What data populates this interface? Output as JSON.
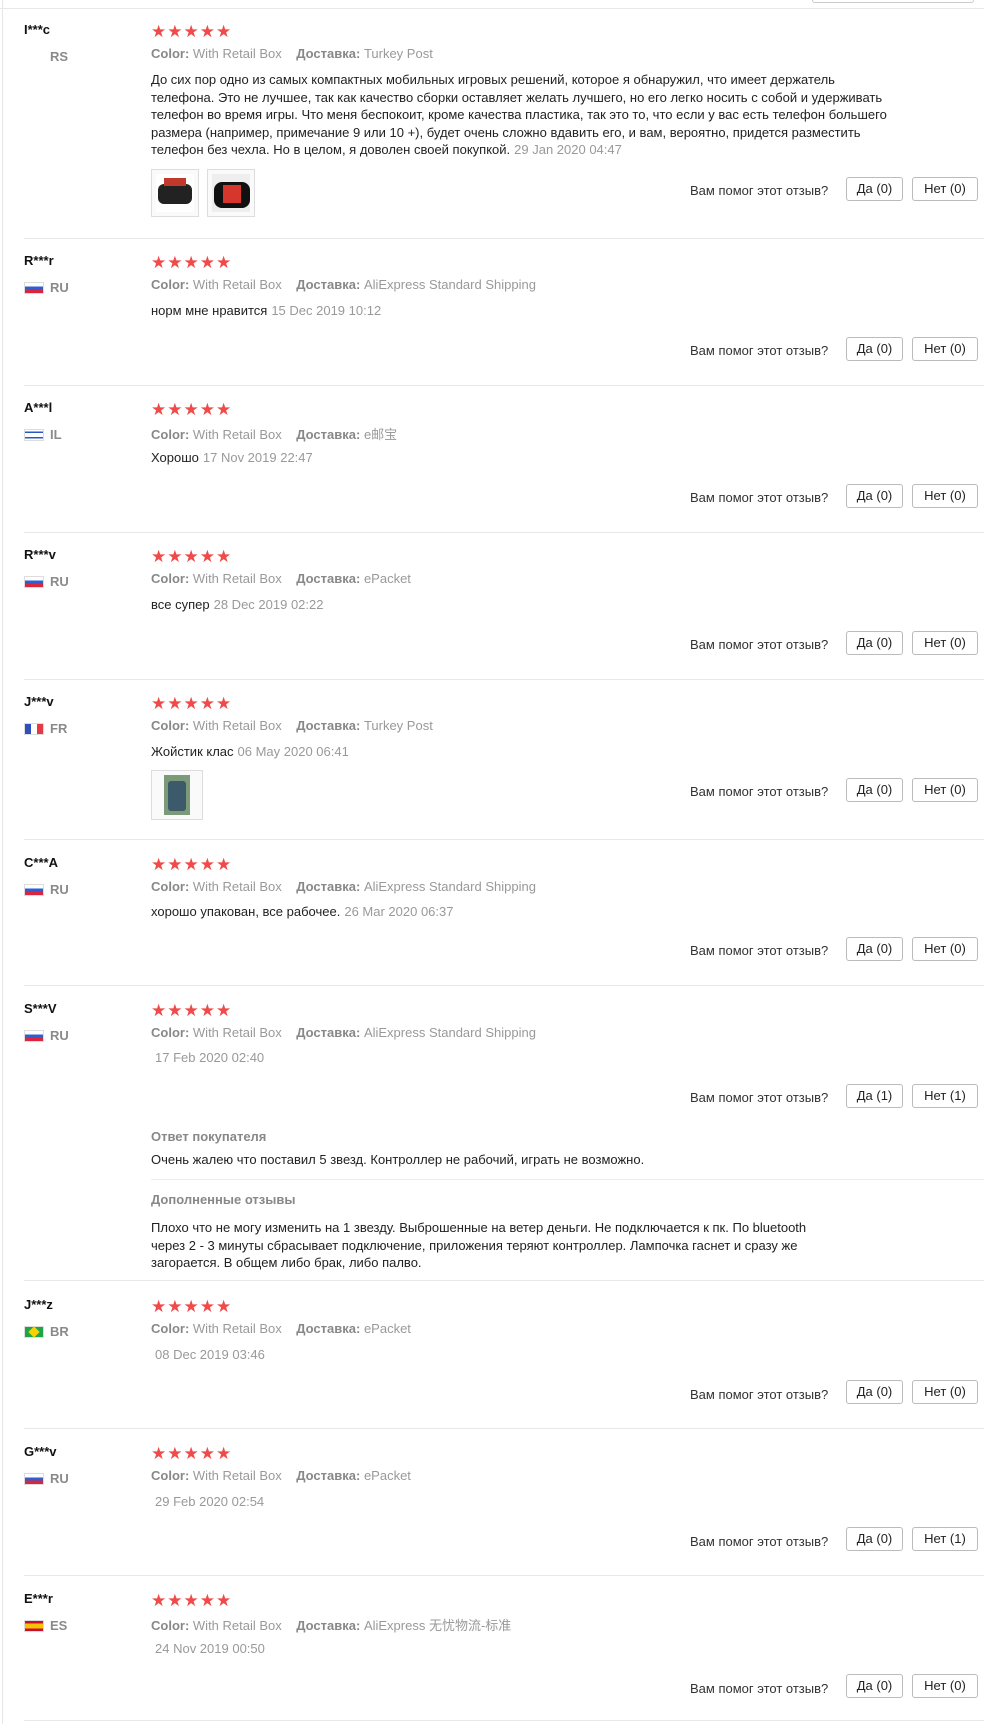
{
  "labels": {
    "color": "Color:",
    "shipping": "Доставка:",
    "helpful": "Вам помог этот отзыв?",
    "buyer_reply": "Ответ покупателя",
    "additional": "Дополненные отзывы"
  },
  "reviews": [
    {
      "user": "I***c",
      "country": "RS",
      "flag": "none",
      "stars": "★★★★★",
      "color": "With Retail Box",
      "shipping": "Turkey Post",
      "text": "До сих пор одно из самых компактных мобильных игровых решений, которое я обнаружил, что имеет держатель телефона. Это не лучшее, так как качество сборки оставляет желать лучшего, но его легко носить с собой и удерживать телефон во время игры. Что меня беспокоит, кроме качества пластика, так это то, что если у вас есть телефон большего размера (например, примечание 9 или 10 +), будет очень сложно вдавить его, и вам, вероятно, придется разместить телефон без чехла. Но в целом, я доволен своей покупкой.",
      "date": "29 Jan 2020 04:47",
      "yes": "Да (0)",
      "no": "Нет (0)"
    },
    {
      "user": "R***r",
      "country": "RU",
      "flag": "ru",
      "stars": "★★★★★",
      "color": "With Retail Box",
      "shipping": "AliExpress Standard Shipping",
      "text": "норм мне нравится",
      "date": "15 Dec 2019 10:12",
      "yes": "Да (0)",
      "no": "Нет (0)"
    },
    {
      "user": "A***l",
      "country": "IL",
      "flag": "il",
      "stars": "★★★★★",
      "color": "With Retail Box",
      "shipping": "e邮宝",
      "text": "Хорошо",
      "date": "17 Nov 2019 22:47",
      "yes": "Да (0)",
      "no": "Нет (0)"
    },
    {
      "user": "R***v",
      "country": "RU",
      "flag": "ru",
      "stars": "★★★★★",
      "color": "With Retail Box",
      "shipping": "ePacket",
      "text": "все супер",
      "date": "28 Dec 2019 02:22",
      "yes": "Да (0)",
      "no": "Нет (0)"
    },
    {
      "user": "J***v",
      "country": "FR",
      "flag": "fr",
      "stars": "★★★★★",
      "color": "With Retail Box",
      "shipping": "Turkey Post",
      "text": "Жойстик клас",
      "date": "06 May 2020 06:41",
      "yes": "Да (0)",
      "no": "Нет (0)"
    },
    {
      "user": "C***A",
      "country": "RU",
      "flag": "ru",
      "stars": "★★★★★",
      "color": "With Retail Box",
      "shipping": "AliExpress Standard Shipping",
      "text": "хорошо упакован, все рабочее.",
      "date": "26 Mar 2020 06:37",
      "yes": "Да (0)",
      "no": "Нет (0)"
    },
    {
      "user": "S***V",
      "country": "RU",
      "flag": "ru",
      "stars": "★★★★★",
      "color": "With Retail Box",
      "shipping": "AliExpress Standard Shipping",
      "text": "",
      "date": "17 Feb 2020 02:40",
      "yes": "Да (1)",
      "no": "Нет (1)",
      "buyer_reply": "Очень жалею что поставил 5 звезд. Контроллер не рабочий, играть не возможно.",
      "additional": "Плохо что не могу изменить на 1 звезду. Выброшенные на ветер деньги. Не подключается к пк. По bluetooth через 2 - 3 минуты сбрасывает подключение, приложения теряют контроллер. Лампочка гаснет и сразу же загорается. В общем либо брак, либо палво."
    },
    {
      "user": "J***z",
      "country": "BR",
      "flag": "br",
      "stars": "★★★★★",
      "color": "With Retail Box",
      "shipping": "ePacket",
      "text": "",
      "date": "08 Dec 2019 03:46",
      "yes": "Да (0)",
      "no": "Нет (0)"
    },
    {
      "user": "G***v",
      "country": "RU",
      "flag": "ru",
      "stars": "★★★★★",
      "color": "With Retail Box",
      "shipping": "ePacket",
      "text": "",
      "date": "29 Feb 2020 02:54",
      "yes": "Да (0)",
      "no": "Нет (1)"
    },
    {
      "user": "E***r",
      "country": "ES",
      "flag": "es",
      "stars": "★★★★★",
      "color": "With Retail Box",
      "shipping": "AliExpress 无忧物流-标准",
      "text": "",
      "date": "24 Nov 2019 00:50",
      "yes": "Да (0)",
      "no": "Нет (0)"
    }
  ]
}
